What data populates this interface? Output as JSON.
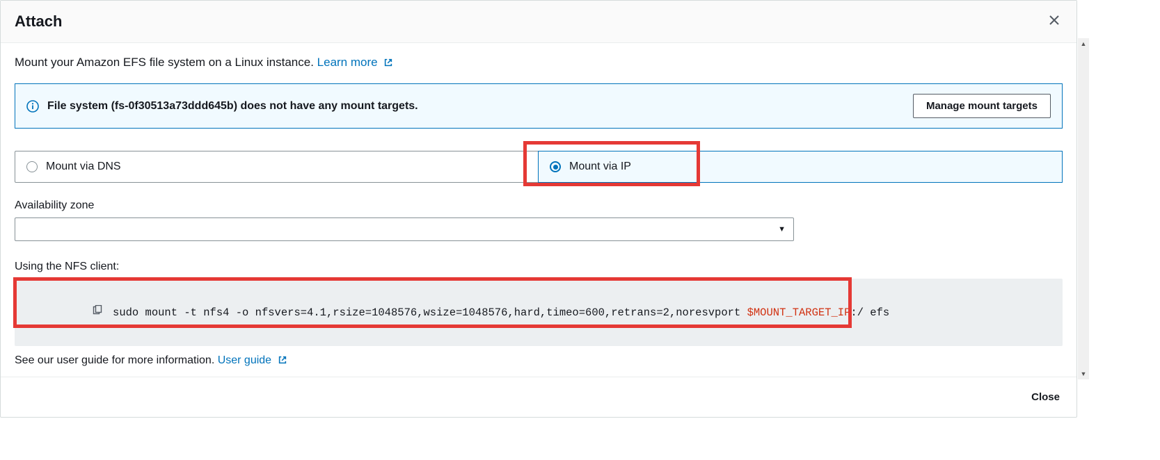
{
  "header": {
    "title": "Attach"
  },
  "intro": {
    "text": "Mount your Amazon EFS file system on a Linux instance. ",
    "learn_more": "Learn more"
  },
  "info": {
    "message": "File system (fs-0f30513a73ddd645b) does not have any mount targets.",
    "manage_btn": "Manage mount targets"
  },
  "mount_options": {
    "dns": "Mount via DNS",
    "ip": "Mount via IP",
    "selected": "ip"
  },
  "az": {
    "label": "Availability zone",
    "value": ""
  },
  "nfs": {
    "label": "Using the NFS client:",
    "cmd_pre": "sudo mount -t nfs4 -o nfsvers=4.1,rsize=1048576,wsize=1048576,hard,timeo=600,retrans=2,noresvport ",
    "cmd_var": "$MOUNT_TARGET_IP",
    "cmd_post": ":/ efs"
  },
  "footer": {
    "text": "See our user guide for more information. ",
    "user_guide": "User guide"
  },
  "buttons": {
    "close": "Close"
  }
}
